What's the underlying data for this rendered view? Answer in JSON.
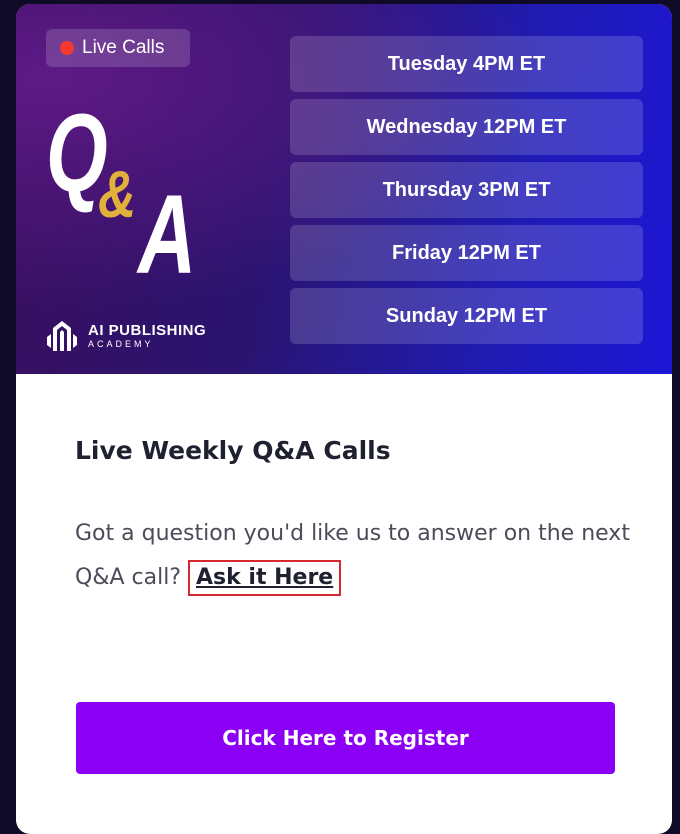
{
  "banner": {
    "live_badge": "Live Calls",
    "qa_logo": {
      "q": "Q",
      "amp": "&",
      "a": "A"
    },
    "brand": {
      "line1": "AI PUBLISHING",
      "line2": "ACADEMY"
    },
    "schedule": [
      "Tuesday 4PM ET",
      "Wednesday 12PM ET",
      "Thursday 3PM ET",
      "Friday 12PM ET",
      "Sunday 12PM ET"
    ]
  },
  "card": {
    "title": "Live Weekly Q&A Calls",
    "text": "Got a question you'd like us to answer on the next Q&A call?",
    "link_label": "Ask it Here",
    "button_label": "Click Here to Register"
  },
  "colors": {
    "accent": "#8b00f4",
    "live_dot": "#f43a2f",
    "ampersand": "#e2b13c",
    "highlight_border": "#d4292f"
  }
}
